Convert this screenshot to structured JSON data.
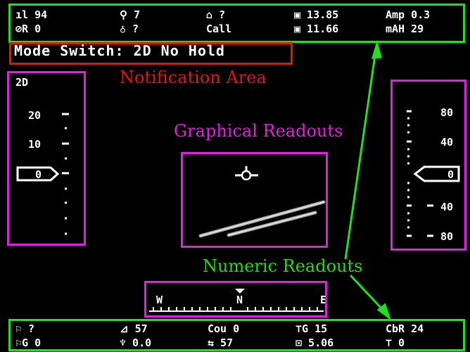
{
  "top_bar": {
    "row1": [
      {
        "icon": "signal-bars-icon",
        "text": "ıl 94"
      },
      {
        "icon": "satellite-icon",
        "text": "⚲ 7"
      },
      {
        "icon": "home-icon",
        "text": "⌂ ?"
      },
      {
        "icon": "battery-icon",
        "text": "▣ 13.85"
      },
      {
        "icon": "amperage-icon",
        "text": "Amp 0.3"
      }
    ],
    "row2": [
      {
        "icon": "rssi-icon",
        "text": "⊘R 0"
      },
      {
        "icon": "altitude-icon",
        "text": "♁ ?"
      },
      {
        "icon": "callsign-icon",
        "text": "Call"
      },
      {
        "icon": "cell-voltage-icon",
        "text": "▣ 11.66"
      },
      {
        "icon": "mah-icon",
        "text": "mAH 29"
      }
    ]
  },
  "notification": "Mode Switch: 2D No Hold",
  "labels": {
    "notification_area": "Notification Area",
    "graphical_readouts": "Graphical Readouts",
    "numeric_readouts": "Numeric Readouts"
  },
  "left_tape": {
    "title": "2D",
    "ticks": [
      "20",
      "10"
    ],
    "current": "0"
  },
  "right_tape": {
    "ticks": [
      "80",
      "40"
    ],
    "current": "0",
    "lower_ticks": [
      "40",
      "80"
    ]
  },
  "compass": {
    "letters": [
      "W",
      "N",
      "E"
    ]
  },
  "bottom_bar": {
    "row1": [
      {
        "icon": "runner-icon",
        "text": "⚐ ?"
      },
      {
        "icon": "climb-angle-icon",
        "text": "⊿ 57"
      },
      {
        "icon": "course-icon",
        "text": "Cou 0"
      },
      {
        "icon": "ground-speed-icon",
        "text": "⊤G 15"
      },
      {
        "icon": "climb-rate-icon",
        "text": "CbR 24"
      }
    ],
    "row2": [
      {
        "icon": "ground-distance-icon",
        "text": "⚐G 0"
      },
      {
        "icon": "vertical-speed-icon",
        "text": "♆ 0.0"
      },
      {
        "icon": "heading-icon",
        "text": "⇆ 57"
      },
      {
        "icon": "flight-time-icon",
        "text": "⊡ 5.06"
      },
      {
        "icon": "throttle-icon",
        "text": "⊤ 0"
      }
    ]
  },
  "colors": {
    "numeric_box": "#22e01d",
    "graphical_box": "#e41ee4",
    "notification_box": "#e5141a",
    "notification_label": "#e5141a",
    "graphical_label": "#e41ee4",
    "numeric_label": "#22e01d"
  }
}
